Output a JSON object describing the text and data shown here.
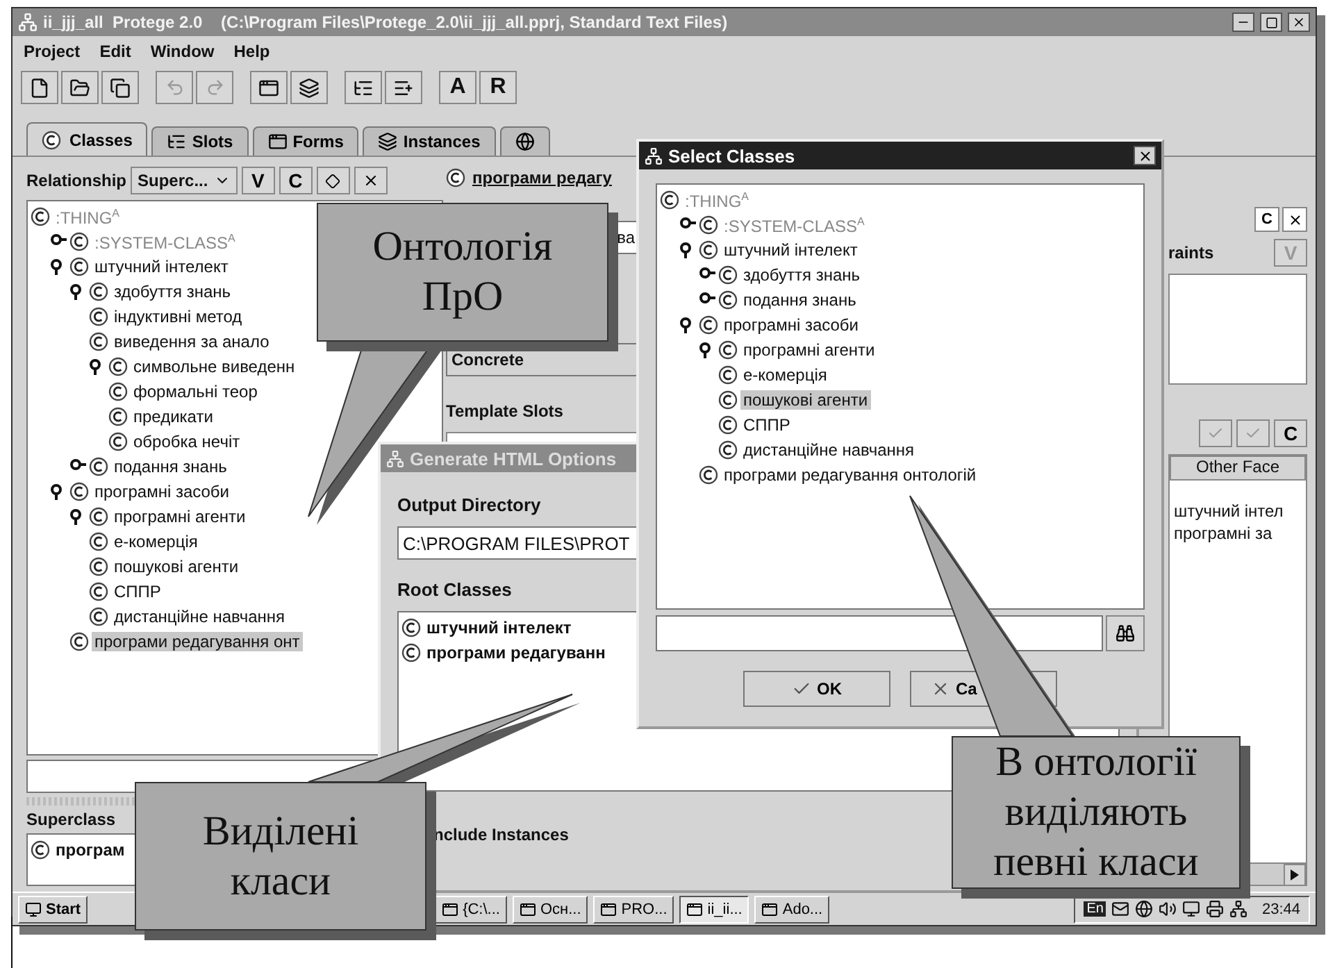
{
  "window": {
    "title": "ii_jjj_all  Protege 2.0    (C:\\Program Files\\Protege_2.0\\ii_jjj_all.pprj, Standard Text Files)"
  },
  "menu": [
    "Project",
    "Edit",
    "Window",
    "Help"
  ],
  "toolbar": {
    "text_buttons": [
      "A",
      "R"
    ]
  },
  "tabs": [
    {
      "kind": "classes",
      "label": "Classes",
      "selected": true
    },
    {
      "kind": "slots",
      "label": "Slots",
      "selected": false
    },
    {
      "kind": "forms",
      "label": "Forms",
      "selected": false
    },
    {
      "kind": "instances",
      "label": "Instances",
      "selected": false
    },
    {
      "kind": "other",
      "selected": false
    }
  ],
  "class_panel": {
    "relationship_label": "Relationship",
    "relationship_value": "Superc...",
    "buttons": [
      "V",
      "C"
    ],
    "tree": [
      {
        "label": ":THING",
        "kind": "system",
        "badge": "A",
        "selected": false,
        "children": [
          {
            "label": ":SYSTEM-CLASS",
            "kind": "system",
            "badge": "A",
            "expanded": false,
            "selected": false
          },
          {
            "label": "штучний інтелект",
            "kind": "class",
            "expanded": true,
            "selected": false,
            "children": [
              {
                "label": "здобуття знань",
                "kind": "class",
                "expanded": true,
                "selected": false,
                "children": [
                  {
                    "label": "індуктивні метод",
                    "kind": "class",
                    "selected": false
                  },
                  {
                    "label": "виведення за анало",
                    "kind": "class",
                    "selected": false
                  },
                  {
                    "label": "символьне виведенн",
                    "kind": "class",
                    "expanded": true,
                    "selected": false,
                    "children": [
                      {
                        "label": "формальні теор",
                        "kind": "class",
                        "selected": false
                      },
                      {
                        "label": "предикати",
                        "kind": "class",
                        "selected": false
                      },
                      {
                        "label": "обробка нечіт",
                        "kind": "class",
                        "selected": false
                      }
                    ]
                  }
                ]
              },
              {
                "label": "подання знань",
                "kind": "class",
                "expanded": false,
                "selected": false
              }
            ]
          },
          {
            "label": "програмні засоби",
            "kind": "class",
            "expanded": true,
            "selected": false,
            "children": [
              {
                "label": "програмні агенти",
                "kind": "class",
                "expanded": true,
                "selected": false,
                "children": [
                  {
                    "label": "е-комерція",
                    "kind": "class",
                    "selected": false
                  },
                  {
                    "label": "пошукові агенти",
                    "kind": "class",
                    "selected": false
                  },
                  {
                    "label": "СППР",
                    "kind": "class",
                    "selected": false
                  },
                  {
                    "label": "дистанційне навчання",
                    "kind": "class",
                    "selected": false
                  }
                ]
              },
              {
                "label": "програми редагування онт",
                "kind": "class",
                "selected": true
              }
            ]
          }
        ]
      }
    ],
    "superclasses_label": "Superclass",
    "superclasses": [
      "програм"
    ]
  },
  "class_form": {
    "title": "програми редагу",
    "name_value": "ва",
    "role": "Concrete",
    "template_slots_label": "Template Slots"
  },
  "side_panel": {
    "button": "C",
    "constraints_label": "raints",
    "constraints_button": "V",
    "facet_button": "C",
    "column": "Other Face",
    "rows": [
      "штучний інтел",
      "програмні за"
    ]
  },
  "html_dialog": {
    "title": "Generate HTML Options",
    "output_label": "Output Directory",
    "output_value": "C:\\PROGRAM FILES\\PROT",
    "root_label": "Root Classes",
    "root_classes": [
      "штучний інтелект",
      "програми редагуванн"
    ],
    "include_instances": "nclude Instances"
  },
  "select_dialog": {
    "title": "Select Classes",
    "tree": [
      {
        "label": ":THING",
        "kind": "system",
        "badge": "A",
        "selected": false,
        "children": [
          {
            "label": ":SYSTEM-CLASS",
            "kind": "system",
            "badge": "A",
            "expanded": false,
            "selected": false
          },
          {
            "label": "штучний інтелект",
            "kind": "class",
            "expanded": true,
            "selected": false,
            "children": [
              {
                "label": "здобуття знань",
                "kind": "class",
                "expanded": false,
                "selected": false
              },
              {
                "label": "подання знань",
                "kind": "class",
                "expanded": false,
                "selected": false
              }
            ]
          },
          {
            "label": "програмні засоби",
            "kind": "class",
            "expanded": true,
            "selected": false,
            "children": [
              {
                "label": "програмні агенти",
                "kind": "class",
                "expanded": true,
                "selected": false,
                "children": [
                  {
                    "label": "е-комерція",
                    "kind": "class",
                    "selected": false
                  },
                  {
                    "label": "пошукові агенти",
                    "kind": "class",
                    "selected": true
                  },
                  {
                    "label": "СППР",
                    "kind": "class",
                    "selected": false
                  },
                  {
                    "label": "дистанційне навчання",
                    "kind": "class",
                    "selected": false
                  }
                ]
              },
              {
                "label": "програми редагування онтологій",
                "kind": "class",
                "selected": false
              }
            ]
          }
        ]
      }
    ],
    "ok": "OK",
    "cancel": "Ca"
  },
  "taskbar": {
    "start": "Start",
    "tasks": [
      {
        "label": "{C:\\...",
        "selected": false
      },
      {
        "label": "Осн...",
        "selected": false
      },
      {
        "label": "PRO...",
        "selected": false
      },
      {
        "label": "ii_ii...",
        "selected": true
      },
      {
        "label": "Ado...",
        "selected": false
      }
    ],
    "language": "En",
    "clock": "23:44"
  },
  "callouts": [
    {
      "lines": [
        "Онтологія",
        "ПрО"
      ]
    },
    {
      "lines": [
        "Виділені",
        "класи"
      ]
    },
    {
      "lines": [
        "В онтології",
        "виділяють",
        "певні класи"
      ]
    }
  ]
}
